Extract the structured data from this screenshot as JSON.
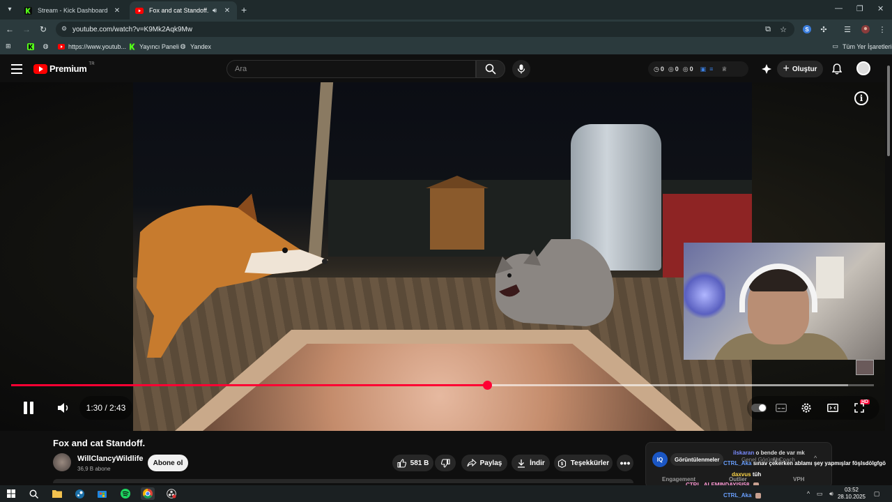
{
  "browser": {
    "tabs": [
      {
        "title": "Stream - Kick Dashboard",
        "active": false,
        "icon": "kick-icon"
      },
      {
        "title": "Fox and cat Standoff. - YouT",
        "active": true,
        "icon": "youtube-icon",
        "audio": true
      }
    ],
    "url": "youtube.com/watch?v=K9Mk2Aqk9Mw",
    "bookmarks": [
      {
        "label": "",
        "icon": "kick-icon"
      },
      {
        "label": "",
        "icon": "globe-icon"
      },
      {
        "label": "https://www.youtub...",
        "icon": "youtube-icon"
      },
      {
        "label": "Yayıncı Paneli",
        "icon": "kick-icon"
      },
      {
        "label": "Yandex",
        "icon": "globe-icon"
      }
    ],
    "all_bookmarks_label": "Tüm Yer İşaretleri"
  },
  "youtube": {
    "logo_text": "Premium",
    "country_code": "TR",
    "search_placeholder": "Ara",
    "ext_counts": [
      "0",
      "0",
      "0"
    ],
    "create_label": "Oluştur"
  },
  "player": {
    "current_time": "1:30",
    "duration": "2:43",
    "time_display": "1:30 / 2:43",
    "progress_fraction": 0.552,
    "buffered_fraction": 0.97,
    "hd_badge": "HD",
    "state": "playing"
  },
  "video": {
    "title": "Fox and cat Standoff.",
    "channel": "WillClancyWildlife",
    "subscribers": "36,9 B abone",
    "subscribe_label": "Abone ol",
    "likes": "581 B",
    "share_label": "Paylaş",
    "download_label": "İndir",
    "thanks_label": "Teşekkürler"
  },
  "extension": {
    "badge": "IQ",
    "tabs": [
      "Görüntülenmeler",
      "Genel Görünüm",
      "AI Coach"
    ],
    "metrics": [
      "Engagement",
      "Outlier",
      "VPH"
    ]
  },
  "chat": [
    {
      "user": "ilskaran",
      "message": "o bende de var mk"
    },
    {
      "user": "CTRL_Aka",
      "message": "sınav çekerken ablamı şey yapmışlar föşlsdölgfgö"
    },
    {
      "user": "daxvus",
      "message": "tüh"
    },
    {
      "user": "CTRL_ALEMINDAYISI58",
      "message": ""
    },
    {
      "user": "CTRL_Aka",
      "message": ""
    }
  ],
  "taskbar": {
    "time": "03:52",
    "date": "28.10.2025"
  },
  "colors": {
    "accent_red": "#ff0033",
    "youtube_red": "#ff0000",
    "kick_green": "#53fc18",
    "browser_bg": "#2b3a3d"
  }
}
